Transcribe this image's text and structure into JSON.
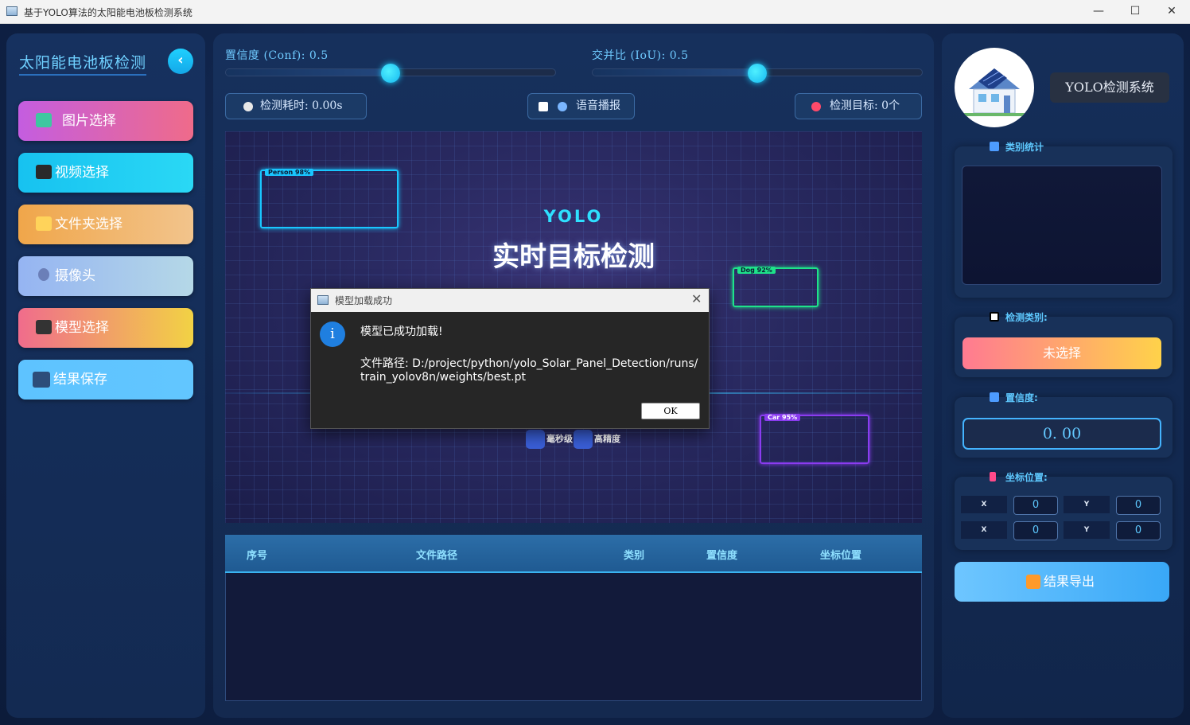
{
  "window": {
    "title": "基于YOLO算法的太阳能电池板检测系统",
    "minimize": "—",
    "maximize": "☐",
    "close": "✕"
  },
  "sidebar": {
    "brand": "太阳能电池板检测",
    "collapse_icon": "‹",
    "items": [
      {
        "label": "图片选择",
        "icon": "image-icon",
        "colors": [
          "#c45de0",
          "#ef6b8a"
        ]
      },
      {
        "label": "视频选择",
        "icon": "clapper-icon",
        "colors": [
          "#17c2f0",
          "#2ad8f5"
        ]
      },
      {
        "label": "文件夹选择",
        "icon": "folder-icon",
        "colors": [
          "#f0a64a",
          "#f2c48c"
        ]
      },
      {
        "label": "摄像头",
        "icon": "webcam-icon",
        "colors": [
          "#95b4f2",
          "#b5d8e7"
        ]
      },
      {
        "label": "模型选择",
        "icon": "model-icon",
        "colors": [
          "#f06c8c",
          "#f2d244"
        ]
      },
      {
        "label": "结果保存",
        "icon": "save-icon",
        "colors": [
          "#5ec3ff",
          "#62c6ff"
        ]
      }
    ]
  },
  "controls": {
    "conf_label": "置信度 (Conf): 0.5",
    "conf_value": 0.5,
    "iou_label": "交并比 (IoU): 0.5",
    "iou_value": 0.5,
    "time_label": "检测耗时: 0.00s",
    "voice_label": "语音播报",
    "target_label": "检测目标: 0个"
  },
  "preview": {
    "yolo": "YOLO",
    "title": "实时目标检测",
    "boxes": [
      {
        "tag": "Person 98%",
        "color": "#19c6ff"
      },
      {
        "tag": "Dog 92%",
        "color": "#1ee38a"
      },
      {
        "tag": "Car 95%",
        "color": "#8a3cf0"
      }
    ],
    "chip1": "毫秒级",
    "chip2": "高精度"
  },
  "table": {
    "columns": [
      "序号",
      "文件路径",
      "类别",
      "置信度",
      "坐标位置"
    ],
    "rows": []
  },
  "right": {
    "system_name": "YOLO检测系统",
    "stats_label": "类别统计",
    "class_label": "检测类别:",
    "class_value": "未选择",
    "conf_label": "置信度:",
    "conf_value": "0. 00",
    "coord_label": "坐标位置:",
    "coords": {
      "x1_label": "X",
      "y1_label": "Y",
      "x2_label": "X",
      "y2_label": "Y",
      "x1": "0",
      "y1": "0",
      "x2": "0",
      "y2": "0"
    },
    "export_label": "结果导出"
  },
  "dialog": {
    "title": "模型加载成功",
    "close": "✕",
    "icon": "i",
    "message": "模型已成功加载!",
    "path_line1": "文件路径: D:/project/python/yolo_Solar_Panel_Detection/runs/",
    "path_line2": "train_yolov8n/weights/best.pt",
    "ok": "OK"
  }
}
